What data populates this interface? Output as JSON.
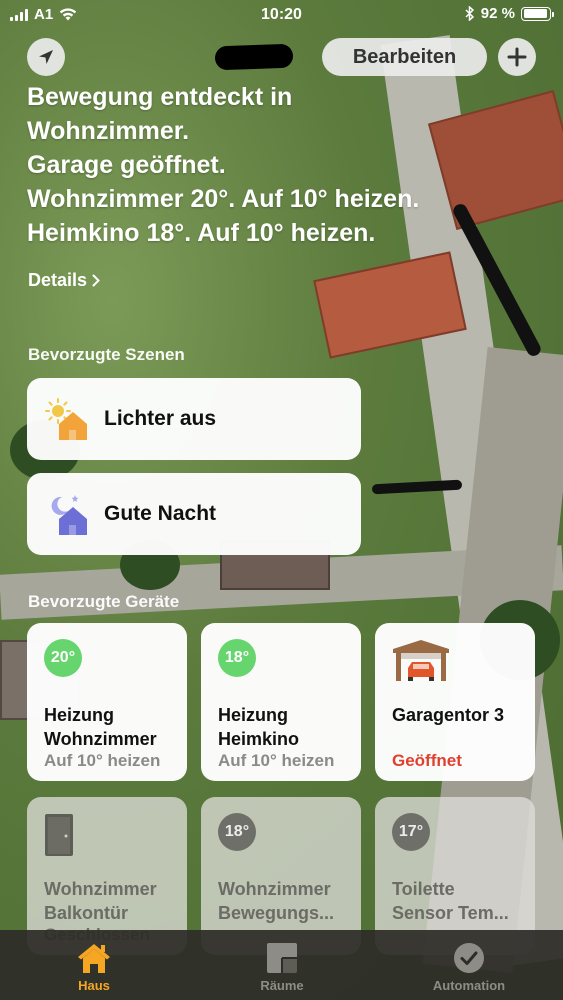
{
  "status_bar": {
    "carrier": "A1",
    "time": "10:20",
    "battery_percent": "92 %",
    "battery_level": 0.92
  },
  "nav": {
    "edit_label": "Bearbeiten"
  },
  "summary": {
    "lines": [
      "Bewegung entdeckt in",
      "Wohnzimmer.",
      "Garage geöffnet.",
      "Wohnzimmer 20°. Auf 10° heizen.",
      "Heimkino 18°. Auf 10° heizen."
    ],
    "details_label": "Details"
  },
  "scenes": {
    "title": "Bevorzugte Szenen",
    "items": [
      {
        "label": "Lichter aus",
        "icon": "sun-house-icon"
      },
      {
        "label": "Gute Nacht",
        "icon": "moon-house-icon"
      }
    ]
  },
  "accessories": {
    "title": "Bevorzugte Geräte",
    "items": [
      {
        "badge": "20°",
        "name_line1": "Heizung",
        "name_line2": "Wohnzimmer",
        "status": "Auf 10° heizen",
        "active": true
      },
      {
        "badge": "18°",
        "name_line1": "Heizung",
        "name_line2": "Heimkino",
        "status": "Auf 10° heizen",
        "active": true
      },
      {
        "badge": "",
        "name_line1": "Garagentor 3",
        "name_line2": "",
        "status": "Geöffnet",
        "active": true,
        "icon": "garage-icon"
      },
      {
        "badge": "",
        "name_line1": "Wohnzimmer",
        "name_line2": "Balkontür",
        "status": "Geschlossen",
        "active": false,
        "icon": "door-icon"
      },
      {
        "badge": "18°",
        "name_line1": "Wohnzimmer",
        "name_line2": "Bewegungs...",
        "status": "",
        "active": false
      },
      {
        "badge": "17°",
        "name_line1": "Toilette",
        "name_line2": "Sensor Tem...",
        "status": "",
        "active": false
      }
    ]
  },
  "tabs": [
    {
      "label": "Haus",
      "icon": "house-icon",
      "active": true
    },
    {
      "label": "Räume",
      "icon": "rooms-icon",
      "active": false
    },
    {
      "label": "Automation",
      "icon": "clock-check-icon",
      "active": false
    }
  ],
  "colors": {
    "accent": "#f5a623",
    "heating_active": "#66d56e",
    "alert": "#e0402f",
    "scene_sun": "#f2a33a",
    "scene_night": "#6c6fd6"
  }
}
